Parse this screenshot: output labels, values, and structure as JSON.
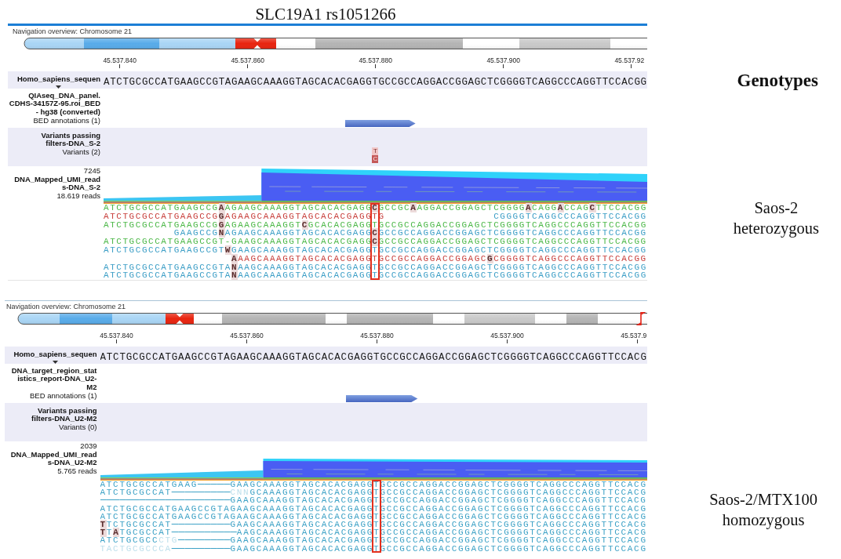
{
  "title": "SLC19A1 rs1051266",
  "genotypes_heading": "Genotypes",
  "panels": [
    {
      "navigation_label": "Navigation overview: Chromosome 21",
      "ruler_ticks": [
        "45.537.840",
        "45.537.860",
        "45.537.880",
        "45.537.900",
        "45.537.92"
      ],
      "reference_track": {
        "name_lines": [
          "Homo_sapiens_sequen"
        ],
        "sequence": "ATCTGCGCCATGAAGCCGTAGAAGCAAAGGTAGCACACGAGGTGCCGCCAGGACCGGAGCTCGGGGTCAGGCCCAGGTTCCACGG"
      },
      "annotation_track": {
        "name_lines": [
          "QIAseq_DNA_panel.",
          "CDHS-34157Z-95.roi_BED",
          "- hg38 (converted)"
        ],
        "subtitle": "BED annotations (1)"
      },
      "variant_track": {
        "name_lines": [
          "Variants passing",
          "filters-DNA_S-2"
        ],
        "subtitle": "Variants (2)",
        "alleles": [
          {
            "base": "T",
            "kind": "reference"
          },
          {
            "base": "C",
            "kind": "alternate"
          }
        ]
      },
      "reads_track": {
        "coverage_max": "7245",
        "name_lines": [
          "DNA_Mapped_UMI_read",
          "s-DNA_S-2"
        ],
        "subtitle": "18.619 reads",
        "variant_outline": true,
        "rows": [
          {
            "reads": [
              {
                "color": "#4cb848",
                "segments": [
                  {
                    "text": "ATCTGCGCCATGAAGCCG**A**AGAAGCAAAGGTAGCACACGAGG**C**GCCGC**A**AGGACCGGAGCTCGGGG**A**CAGG**A**CCAG**C**TTCCACGG",
                    "faded": false
                  }
                ]
              }
            ]
          },
          {
            "reads": [
              {
                "color": "#c8403c",
                "segments": [
                  {
                    "text": "ATCTGCGCCATGAAGCCG**G**AGAAGCAAAGGTAGCACACGAGGTG",
                    "faded": false
                  }
                ]
              },
              {
                "color": "#3c9ec6",
                "segments": [
                  {
                    "text": "                                                             CGGGGTCAGGCCCAGGTTCCACGG",
                    "faded": false
                  }
                ]
              }
            ]
          },
          {
            "reads": [
              {
                "color": "#4cb848",
                "segments": [
                  {
                    "text": "ATCTGCGCCATGAAGCCG**G**AGAAGCAAAGGT**C**GCACACGAGGTGCCGCCAGGACCGGAGCTCGGGGTCAGGCCCAGGTTCCACGG",
                    "faded": false
                  }
                ]
              }
            ]
          },
          {
            "reads": [
              {
                "color": "#3c9ec6",
                "segments": [
                  {
                    "text": "           GAAGCCG**N**AGAAGCAAAGGTAGCACACGAGG**C**GCCGCCAGGACCGGAGCTCGGGGTCAGGCCCAGGTTCCACGG",
                    "faded": false
                  }
                ]
              }
            ]
          },
          {
            "reads": [
              {
                "color": "#4cb848",
                "segments": [
                  {
                    "text": "ATCTGCGCCATGAAGCCGT-GAAGCAAAGGTAGCACACGAGG**C**GCCGCCAGGACCGGAGCTCGGGGTCAGGCCCAGGTTCCACGG",
                    "faded": false
                  }
                ]
              }
            ]
          },
          {
            "reads": [
              {
                "color": "#3c9ec6",
                "segments": [
                  {
                    "text": "ATCTGCGCCATGAAGCCGT**W**GAAGCAAAGGTAGCACACGAGGTGCCGCCAGGACCGGAGCTCGGGGTCAGGCCCAGGTTCCACGG",
                    "faded": false
                  }
                ]
              }
            ]
          },
          {
            "reads": [
              {
                "color": "#c8403c",
                "segments": [
                  {
                    "text": "                    **A**AAGCAAAGGTAGCACACGAGGTGCCGCCAGGACCGGAGC**G**CGGGGTCAGGCCCAGGTTCCACGG",
                    "faded": false
                  }
                ]
              }
            ]
          },
          {
            "reads": [
              {
                "color": "#3c9ec6",
                "segments": [
                  {
                    "text": "ATCTGCGCCATGAAGCCGTA**N**AAGCAAAGGTAGCACACGAGGTGCCGCCAGGACCGGAGCTCGGGGTCAGGCCCAGGTTCCACGG",
                    "faded": false
                  }
                ]
              }
            ]
          },
          {
            "reads": [
              {
                "color": "#3c9ec6",
                "segments": [
                  {
                    "text": "ATCTGCGCCATGAAGCCGTA**N**AAGCAAAGGTAGCACACGAGGTGCCGCCAGGACCGGAGCTCGGGGTCAGGCCCAGGTTCCACGG",
                    "faded": false
                  }
                ]
              }
            ]
          }
        ]
      },
      "genotype_lines": [
        "Saos-2",
        "heterozygous"
      ]
    },
    {
      "navigation_label": "Navigation overview: Chromosome 21",
      "ruler_ticks": [
        "45.537.840",
        "45.537.860",
        "45.537.880",
        "45.537.900",
        "45.537.9"
      ],
      "reference_track": {
        "name_lines": [
          "Homo_sapiens_sequen"
        ],
        "sequence": "ATCTGCGCCATGAAGCCGTAGAAGCAAAGGTAGCACACGAGGTGCCGCCAGGACCGGAGCTCGGGGTCAGGCCCAGGTTCCACG"
      },
      "annotation_track": {
        "name_lines": [
          "DNA_target_region_stat",
          "istics_report-DNA_U2-",
          "M2"
        ],
        "subtitle": "BED annotations (1)"
      },
      "variant_track": {
        "name_lines": [
          "Variants passing",
          "filters-DNA_U2-M2"
        ],
        "subtitle": "Variants (0)"
      },
      "reads_track": {
        "coverage_max": "2039",
        "name_lines": [
          "DNA_Mapped_UMI_read",
          "s-DNA_U2-M2"
        ],
        "subtitle": "5.765 reads",
        "variant_outline": true,
        "rows": [
          {
            "reads": [
              {
                "color": "#3ea2c6",
                "segments": [
                  {
                    "text": "ATCTGCGCCATGAAG—————GAAGCAAAGGTAGCACACGAGGTGCCGCCAGGACCGGAGCTCGGGGTCAGGCCCAGGTTCCACG",
                    "faded": false
                  }
                ]
              }
            ]
          },
          {
            "reads": [
              {
                "color": "#3ea2c6",
                "segments": [
                  {
                    "text": "ATCTGCGCCAT—————————",
                    "faded": false
                  },
                  {
                    "text": "CNN",
                    "faded": true
                  },
                  {
                    "text": "GCAAAGGTAGCACACGAGGTGCCGCCAGGACCGGAGCTCGGGGTCAGGCCCAGGTTCCACG",
                    "faded": false
                  }
                ]
              }
            ]
          },
          {
            "reads": [
              {
                "color": "#3ea2c6",
                "segments": [
                  {
                    "text": "————————————————————GAAGCAAAGGTAGCACACGAGGTGCCGCCAGGACCGGAGCTCGGGGTCAGGCCCAGGTTCCACG",
                    "faded": false
                  }
                ]
              }
            ]
          },
          {
            "reads": [
              {
                "color": "#3ea2c6",
                "segments": [
                  {
                    "text": "ATCTGCGCCATGAAGCCGTAGAAGCAAAGGTAGCACACGAGGTGCCGCCAGGACCGGAGCTCGGGGTCAGGCCCAGGTTCCACG",
                    "faded": false
                  }
                ]
              }
            ]
          },
          {
            "reads": [
              {
                "color": "#3ea2c6",
                "segments": [
                  {
                    "text": "ATCTGCGCCATGAAGCCGTAGAAGCAAAGGTAGCACACGAGGTGCCGCCAGGACCGGAGCTCGGGGTCAGGCCCAGGTTCCACG",
                    "faded": false
                  }
                ]
              }
            ]
          },
          {
            "reads": [
              {
                "color": "#3ea2c6",
                "segments": [
                  {
                    "text": "**T**TCTGCGCCAT—————————GAAGCAAAGGTAGCACACGAGGTGCCGCCAGGACCGGAGCTCGGGGTCAGGCCCAGGTTCCACG",
                    "faded": false
                  }
                ]
              }
            ]
          },
          {
            "reads": [
              {
                "color": "#3ea2c6",
                "segments": [
                  {
                    "text": "**T**T**A**TGCGCCAT——————————AAGCAAAGGTAGCACACGAGGTGCCGCCAGGACCGGAGCTCGGGGTCAGGCCCAGGTTCCACG",
                    "faded": false
                  }
                ]
              }
            ]
          },
          {
            "reads": [
              {
                "color": "#3ea2c6",
                "segments": [
                  {
                    "text": "ATCTGCGCC",
                    "faded": false
                  },
                  {
                    "text": "CTG",
                    "faded": true
                  },
                  {
                    "text": "————————GAAGCAAAGGTAGCACACGAGGTGCCGCCAGGACCGGAGCTCGGGGTCAGGCCCAGGTTCCACG",
                    "faded": false
                  }
                ]
              }
            ]
          },
          {
            "reads": [
              {
                "color": "#3ea2c6",
                "segments": [
                  {
                    "text": "TACTGCGCCCA",
                    "faded": true
                  },
                  {
                    "text": "—————————GAAGCAAAGGTAGCACACGAGGTGCCGCCAGGACCGGAGCTCGGGGTCAGGCCCAGGTTCCACG",
                    "faded": false
                  }
                ]
              }
            ]
          }
        ]
      },
      "genotype_lines": [
        "Saos-2/MTX100",
        "homozygous"
      ]
    }
  ]
}
